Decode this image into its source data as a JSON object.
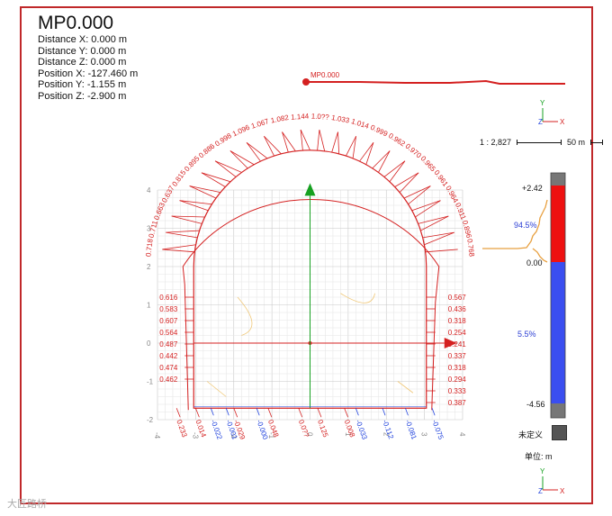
{
  "header": {
    "title": "MP0.000",
    "rows": [
      "Distance X: 0.000 m",
      "Distance Y: 0.000 m",
      "Distance Z: 0.000 m",
      "Position X: -127.460 m",
      "Position Y: -1.155 m",
      "Position Z: -2.900 m"
    ]
  },
  "profile": {
    "label": "MP0.000"
  },
  "axes": {
    "y_label": "Y",
    "z_label": "Z",
    "x_label": "X"
  },
  "scale_bar": {
    "ratio": "1 : 2,827",
    "length": "50 m"
  },
  "colorbar": {
    "max": "+2.42",
    "zero": "0.00",
    "min": "-4.56",
    "pct_pos": "94.5%",
    "pct_neg": "5.5%",
    "undefined_label": "未定义",
    "unit_label": "单位:  m",
    "colors": {
      "pos": "#ee1111",
      "neg": "#3a4ef0",
      "cap": "#777777",
      "hist": "#e8a040"
    }
  },
  "watermark": "大匠路桥",
  "chart_data": {
    "type": "radial-deviation-profile",
    "axis_ticks_x": [
      "-4",
      "-3",
      "-2",
      "-1",
      "0",
      "1",
      "2",
      "3",
      "4"
    ],
    "axis_ticks_y": [
      "-2",
      "-1",
      "0",
      "1",
      "2",
      "3",
      "4"
    ],
    "arc_labels": [
      "0.718",
      "0.711",
      "0.663",
      "0.637",
      "0.815",
      "0.895",
      "0.886",
      "0.998",
      "1.096",
      "1.067",
      "1.082",
      "1.144",
      "1.0??",
      "1.033",
      "1.014",
      "0.999",
      "0.962",
      "0.970",
      "0.965",
      "0.961",
      "0.964",
      "0.911",
      "0.896",
      "0.768"
    ],
    "left_wall_labels": [
      "0.616",
      "0.583",
      "0.607",
      "0.564",
      "0.487",
      "0.442",
      "0.474",
      "0.462"
    ],
    "right_wall_labels": [
      "0.567",
      "0.436",
      "0.318",
      "0.254",
      "0.241",
      "0.337",
      "0.318",
      "0.294",
      "0.333",
      "0.387"
    ],
    "bottom_labels_red": [
      "0.233",
      "0.014",
      "-0.029",
      "0.048",
      "0.0??",
      "0.125",
      "0.008"
    ],
    "bottom_labels_blue": [
      "-0.022",
      "-0.001",
      "-0.000",
      "-0.033",
      "-0.112",
      "-0.081",
      "-0.075"
    ],
    "colorbar_range": [
      -4.56,
      2.42
    ],
    "positive_fraction_pct": 94.5,
    "negative_fraction_pct": 5.5,
    "xlim": [
      -4,
      4
    ],
    "ylim": [
      -2,
      4
    ]
  }
}
